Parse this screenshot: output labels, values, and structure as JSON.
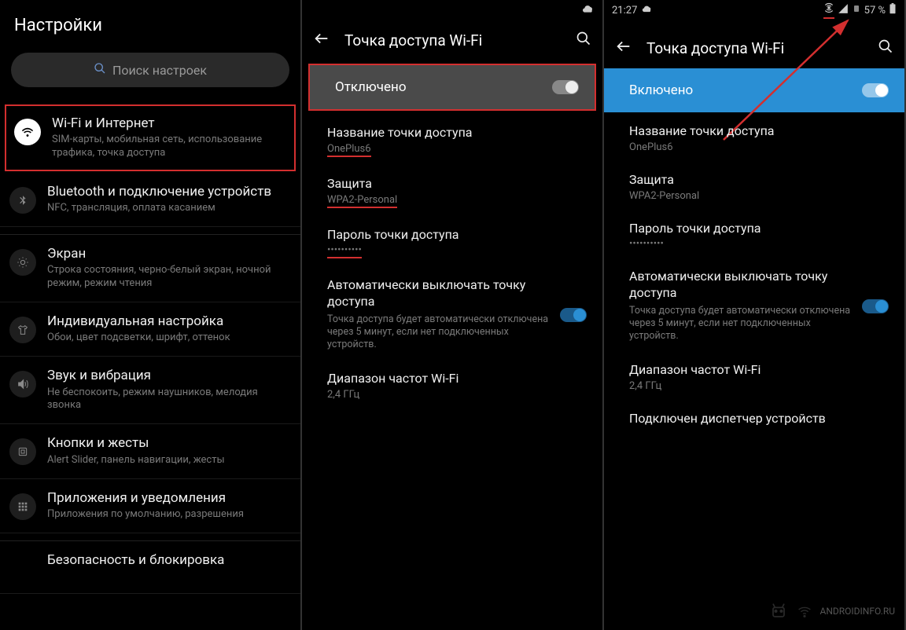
{
  "panel1": {
    "title": "Настройки",
    "search_placeholder": "Поиск настроек",
    "items": [
      {
        "title": "Wi-Fi и Интернет",
        "sub": "SIM-карты, мобильная сеть, использование трафика, точка доступа"
      },
      {
        "title": "Bluetooth и подключение устройств",
        "sub": "NFC, трансляция, оплата касанием"
      },
      {
        "title": "Экран",
        "sub": "Строка состояния, черно-белый экран, ночной режим, режим чтения"
      },
      {
        "title": "Индивидуальная настройка",
        "sub": "Обои, цвет подсветки, шрифт, оттенок"
      },
      {
        "title": "Звук и вибрация",
        "sub": "Не беспокоить, режим наушников, мелодия звонка"
      },
      {
        "title": "Кнопки и жесты",
        "sub": "Alert Slider, панель навигации, жесты"
      },
      {
        "title": "Приложения и уведомления",
        "sub": "Приложения по умолчанию, разрешения"
      },
      {
        "title": "Безопасность и блокировка",
        "sub": ""
      }
    ]
  },
  "panel2": {
    "header": "Точка доступа Wi-Fi",
    "toggle_label": "Отключено",
    "items": [
      {
        "title": "Название точки доступа",
        "sub": "OnePlus6",
        "underline_sub": true
      },
      {
        "title": "Защита",
        "sub": "WPA2-Personal",
        "underline_sub": true
      },
      {
        "title": "Пароль точки доступа",
        "sub": "••••••••••",
        "underline_sub": true
      },
      {
        "title": "Автоматически выключать точку доступа",
        "desc": "Точка доступа будет автоматически отключена через 5 минут, если нет подключенных устройств.",
        "toggle": true
      },
      {
        "title": "Диапазон частот Wi-Fi",
        "sub": "2,4 ГГц"
      }
    ]
  },
  "panel3": {
    "status_time": "21:27",
    "status_battery": "57 %",
    "header": "Точка доступа Wi-Fi",
    "toggle_label": "Включено",
    "items": [
      {
        "title": "Название точки доступа",
        "sub": "OnePlus6"
      },
      {
        "title": "Защита",
        "sub": "WPA2-Personal"
      },
      {
        "title": "Пароль точки доступа",
        "sub": "••••••••••"
      },
      {
        "title": "Автоматически выключать точку доступа",
        "desc": "Точка доступа будет автоматически отключена через 5 минут, если нет подключенных устройств.",
        "toggle": true
      },
      {
        "title": "Диапазон частот Wi-Fi",
        "sub": "2,4 ГГц"
      },
      {
        "title": "Подключен диспетчер устройств"
      }
    ]
  },
  "watermark": "ANDROIDINFO.RU"
}
